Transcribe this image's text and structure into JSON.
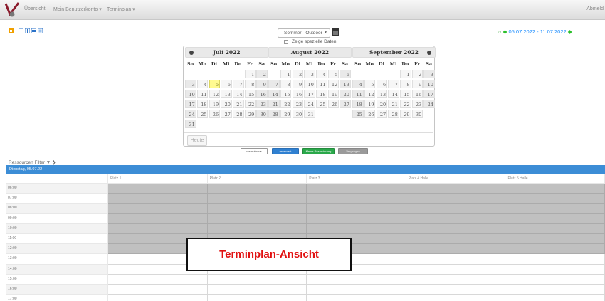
{
  "nav": {
    "items": [
      "Übersicht",
      "Mein Benutzerkonto ▾",
      "Terminplan ▾"
    ],
    "logout": "Abmeld"
  },
  "toolbar": {
    "icons": [
      "export-icon",
      "view-list-icon",
      "view-grid-icon",
      "view-week-icon",
      "view-month-icon"
    ]
  },
  "filter": {
    "select_value": "Sommer - Outdoor",
    "checkbox_label": "Zeige spezielle Daten"
  },
  "range": {
    "text": "05.07.2022 - 11.07.2022"
  },
  "datepicker": {
    "weekdays": [
      "So",
      "Mo",
      "Di",
      "Mi",
      "Do",
      "Fr",
      "Sa"
    ],
    "months": [
      {
        "title": "Juli 2022",
        "offset": 5,
        "days": 31,
        "selected": 5
      },
      {
        "title": "August 2022",
        "offset": 1,
        "days": 31,
        "selected": null
      },
      {
        "title": "September 2022",
        "offset": 4,
        "days": 30,
        "selected": null
      }
    ],
    "today_label": "Heute"
  },
  "buttons": {
    "reserve": "reservierbar",
    "reserved": "reserviert",
    "mine": "Meine Reservierung",
    "past": "Vergangen"
  },
  "schedule": {
    "filter_label": "Ressourcen Filter ▼ ❯",
    "date_label": "Dienstag, 05.07.22",
    "places": [
      "Platz 1",
      "Platz 2",
      "Platz 3",
      "Platz 4 Halle",
      "Platz 5 Halle"
    ],
    "times": [
      "06:00",
      "07:00",
      "08:00",
      "09:00",
      "10:00",
      "11:00",
      "12:00",
      "13:00",
      "14:00",
      "15:00",
      "16:00",
      "17:00"
    ],
    "busy_rows": 7
  },
  "overlay": {
    "text": "Terminplan-Ansicht"
  },
  "colors": {
    "accent": "#3c8dd6",
    "reserved": "#2f80d1",
    "mine": "#2aa84a",
    "past": "#9a9a9a",
    "selected_day": "#fffa90",
    "overlay_text": "#e11010"
  }
}
